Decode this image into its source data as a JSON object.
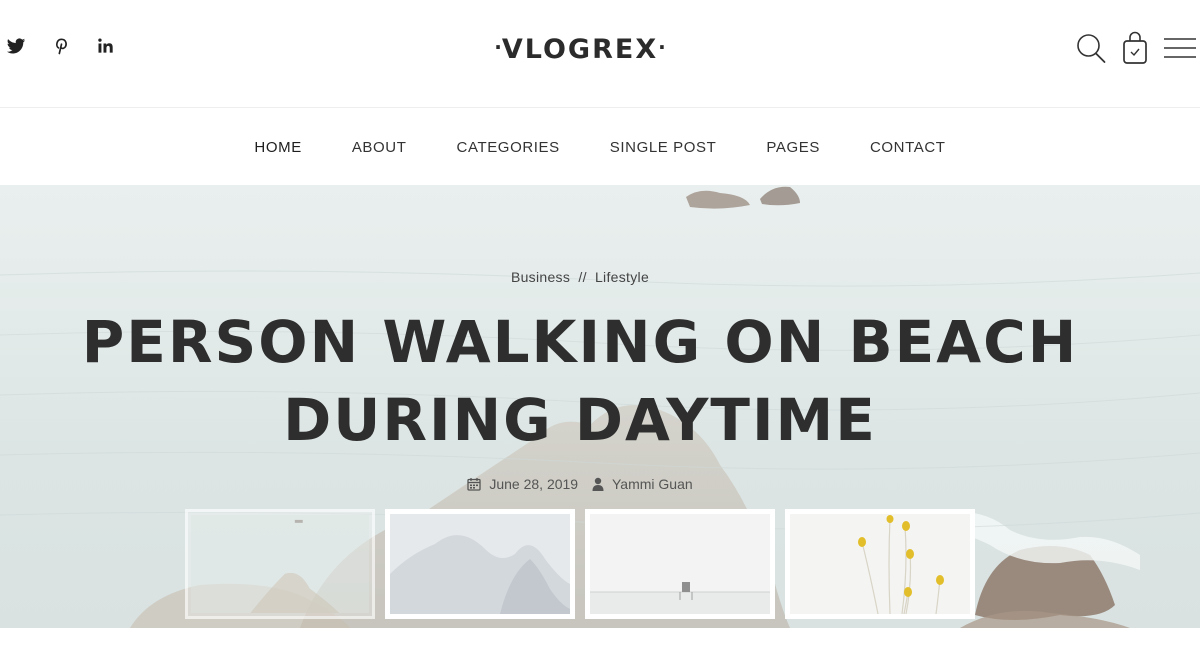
{
  "header": {
    "social": [
      {
        "name": "twitter-icon"
      },
      {
        "name": "pinterest-icon"
      },
      {
        "name": "linkedin-icon"
      }
    ],
    "logo": {
      "dot_left": "·",
      "text": "VLOGREX",
      "dot_right": "·"
    },
    "tools": [
      {
        "name": "search-icon"
      },
      {
        "name": "shopping-bag-icon"
      },
      {
        "name": "hamburger-menu-icon"
      }
    ]
  },
  "nav": {
    "items": [
      {
        "label": "HOME"
      },
      {
        "label": "ABOUT"
      },
      {
        "label": "CATEGORIES"
      },
      {
        "label": "SINGLE POST"
      },
      {
        "label": "PAGES"
      },
      {
        "label": "CONTACT"
      }
    ]
  },
  "hero": {
    "category_1": "Business",
    "category_sep": "//",
    "category_2": "Lifestyle",
    "title_line_1": "PERSON WALKING ON BEACH",
    "title_line_2": "DURING DAYTIME",
    "date": "June 28, 2019",
    "author": "Yammi Guan",
    "date_icon": "calendar-icon",
    "author_icon": "user-icon"
  },
  "colors": {
    "text_dark": "#2e2e2e",
    "hero_bg": "#e2eae9",
    "nav_text": "#333333"
  }
}
